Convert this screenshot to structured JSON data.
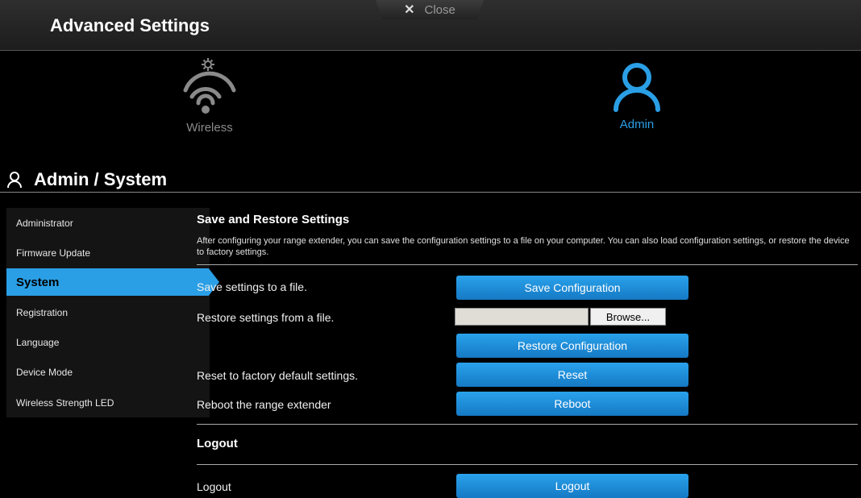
{
  "header": {
    "title": "Advanced Settings",
    "close_label": "Close"
  },
  "nav": {
    "wireless_label": "Wireless",
    "admin_label": "Admin",
    "active_color": "#2a9fe6",
    "inactive_color": "#8a8a8a"
  },
  "section": {
    "title": "Admin / System"
  },
  "sidebar": {
    "items": [
      {
        "label": "Administrator"
      },
      {
        "label": "Firmware Update"
      },
      {
        "label": "System"
      },
      {
        "label": "Registration"
      },
      {
        "label": "Language"
      },
      {
        "label": "Device Mode"
      },
      {
        "label": "Wireless Strength LED"
      }
    ],
    "active": "System"
  },
  "save_restore": {
    "heading": "Save and Restore Settings",
    "description": "After configuring your range extender, you can save the configuration settings to a file on your computer. You can also load configuration settings, or restore the device to factory settings.",
    "save_label": "Save settings to a file.",
    "save_button": "Save Configuration",
    "restore_label": "Restore settings from a file.",
    "file_value": "",
    "browse_button": "Browse...",
    "restore_button": "Restore Configuration",
    "reset_label": "Reset to factory default settings.",
    "reset_button": "Reset",
    "reboot_label": "Reboot the range extender",
    "reboot_button": "Reboot"
  },
  "logout": {
    "heading": "Logout",
    "label": "Logout",
    "button": "Logout"
  }
}
